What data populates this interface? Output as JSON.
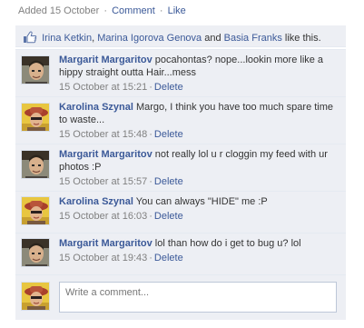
{
  "post_meta": {
    "added_text": "Added 15 October",
    "separator": "·",
    "comment_label": "Comment",
    "like_label": "Like"
  },
  "likes": {
    "icon": "thumbs-up-icon",
    "names": [
      "Irina Ketkin",
      "Marina Igorova Genova",
      "Basia Franks"
    ],
    "comma": ",",
    "and_text": "and",
    "suffix": "like this."
  },
  "comments": [
    {
      "author": "Margarit Margaritov",
      "text": "pocahontas? nope...lookin more like a hippy straight outta Hair...mess",
      "time": "15 October at 15:21",
      "dot": "·",
      "delete_label": "Delete",
      "avatar": "male-avatar"
    },
    {
      "author": "Karolina Szynal",
      "text": "Margo, I think you have too much spare time to waste...",
      "time": "15 October at 15:48",
      "dot": "·",
      "delete_label": "Delete",
      "avatar": "female-avatar"
    },
    {
      "author": "Margarit Margaritov",
      "text": "not really lol u r cloggin my feed with ur photos :P",
      "time": "15 October at 15:57",
      "dot": "·",
      "delete_label": "Delete",
      "avatar": "male-avatar"
    },
    {
      "author": "Karolina Szynal",
      "text": "You can always \"HIDE\" me :P",
      "time": "15 October at 16:03",
      "dot": "·",
      "delete_label": "Delete",
      "avatar": "female-avatar"
    },
    {
      "author": "Margarit Margaritov",
      "text": "lol than how do i get to bug u? lol",
      "time": "15 October at 19:43",
      "dot": "·",
      "delete_label": "Delete",
      "avatar": "male-avatar"
    }
  ],
  "composer": {
    "placeholder": "Write a comment..."
  },
  "colors": {
    "link": "#3b5998",
    "panel": "#edeff4",
    "meta": "#808080"
  }
}
